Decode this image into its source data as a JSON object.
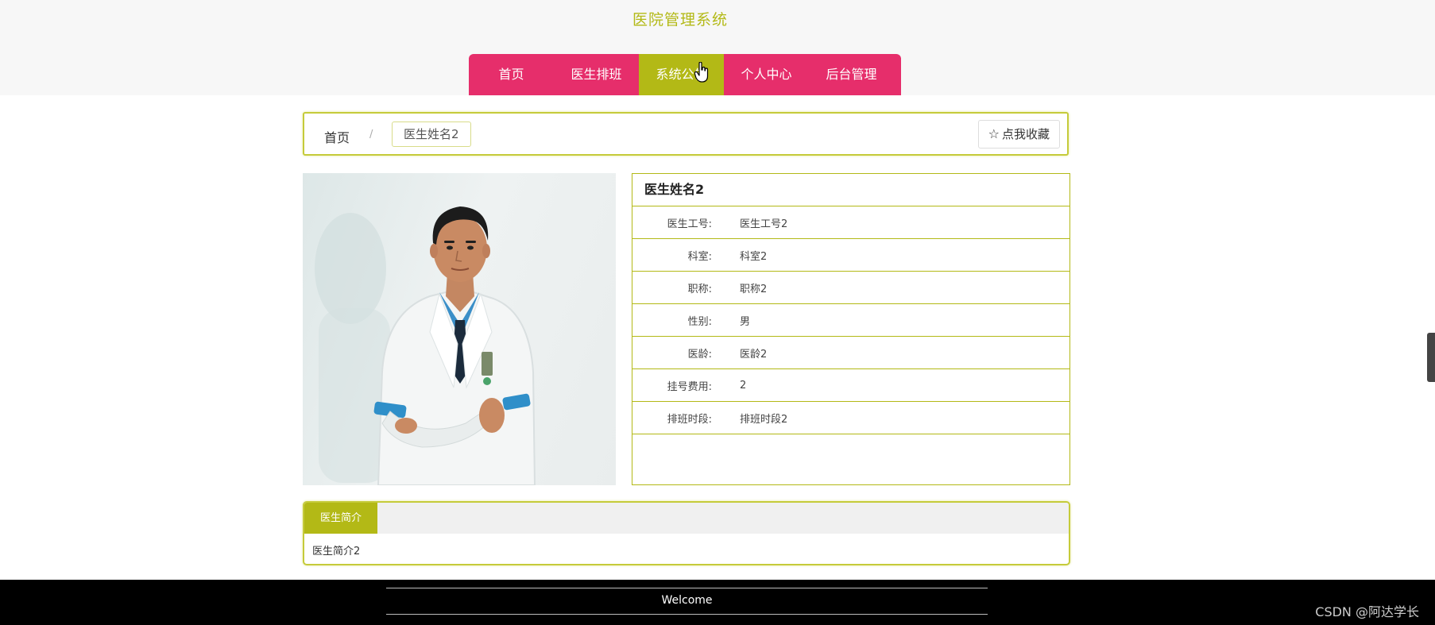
{
  "site": {
    "title": "医院管理系统"
  },
  "nav": {
    "items": [
      {
        "label": "首页"
      },
      {
        "label": "医生排班"
      },
      {
        "label": "系统公告"
      },
      {
        "label": "个人中心"
      },
      {
        "label": "后台管理"
      }
    ],
    "active_index": 2
  },
  "breadcrumb": {
    "home": "首页",
    "separator": "/",
    "current": "医生姓名2",
    "favorite_label": "点我收藏",
    "favorite_icon": "star-outline-icon"
  },
  "doctor": {
    "name": "医生姓名2",
    "fields": [
      {
        "label": "医生工号:",
        "value": "医生工号2"
      },
      {
        "label": "科室:",
        "value": "科室2"
      },
      {
        "label": "职称:",
        "value": "职称2"
      },
      {
        "label": "性别:",
        "value": "男"
      },
      {
        "label": "医龄:",
        "value": "医龄2"
      },
      {
        "label": "挂号费用:",
        "value": "2"
      },
      {
        "label": "排班时段:",
        "value": "排班时段2"
      }
    ]
  },
  "intro": {
    "tab_label": "医生简介",
    "content": "医生简介2"
  },
  "footer": {
    "text": "Welcome"
  },
  "watermark": "CSDN @阿达学长",
  "colors": {
    "accent": "#b3b916",
    "nav_bg": "#e62e6b",
    "footer_bg": "#000000"
  }
}
